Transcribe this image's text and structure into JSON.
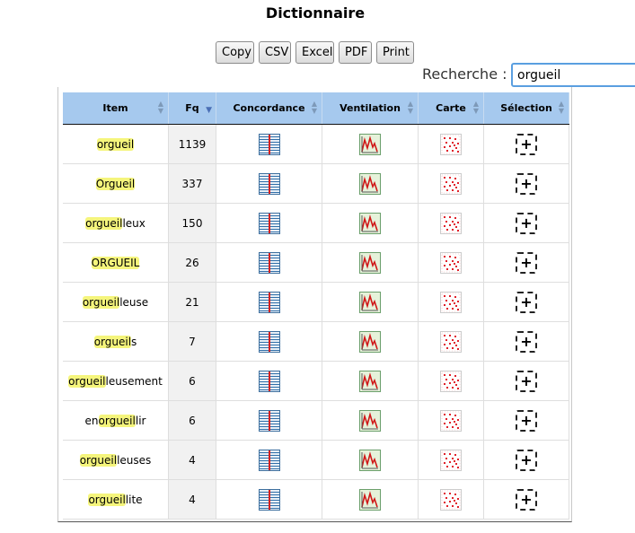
{
  "page": {
    "title": "Dictionnaire"
  },
  "toolbar": {
    "buttons": [
      "Copy",
      "CSV",
      "Excel",
      "PDF",
      "Print"
    ]
  },
  "search": {
    "label": "Recherche :",
    "value": "orgueil"
  },
  "table": {
    "columns": [
      "Item",
      "Fq",
      "Concordance",
      "Ventilation",
      "Carte",
      "Sélection"
    ],
    "sorted_column": "Fq",
    "sort_direction": "descending",
    "rows": [
      {
        "pre": "",
        "hl": "orgueil",
        "post": "",
        "fq": "1139"
      },
      {
        "pre": "",
        "hl": "Orgueil",
        "post": "",
        "fq": "337"
      },
      {
        "pre": "",
        "hl": "orgueil",
        "post": "leux",
        "fq": "150"
      },
      {
        "pre": "",
        "hl": "ORGUEIL",
        "post": "",
        "fq": "26"
      },
      {
        "pre": "",
        "hl": "orgueil",
        "post": "leuse",
        "fq": "21"
      },
      {
        "pre": "",
        "hl": "orgueil",
        "post": "s",
        "fq": "7"
      },
      {
        "pre": "",
        "hl": "orgueil",
        "post": "leusement",
        "fq": "6"
      },
      {
        "pre": "en",
        "hl": "orgueil",
        "post": "lir",
        "fq": "6"
      },
      {
        "pre": "",
        "hl": "orgueil",
        "post": "leuses",
        "fq": "4"
      },
      {
        "pre": "",
        "hl": "orgueil",
        "post": "lite",
        "fq": "4"
      }
    ],
    "icons": {
      "concordance": "concordance-icon",
      "ventilation": "ventilation-chart-icon",
      "carte": "map-grid-icon",
      "selection": "add-selection-icon"
    }
  },
  "colors": {
    "header_bg": "#a6c9ee",
    "highlight": "#f5f57c",
    "search_focus": "#5a9fe0"
  }
}
